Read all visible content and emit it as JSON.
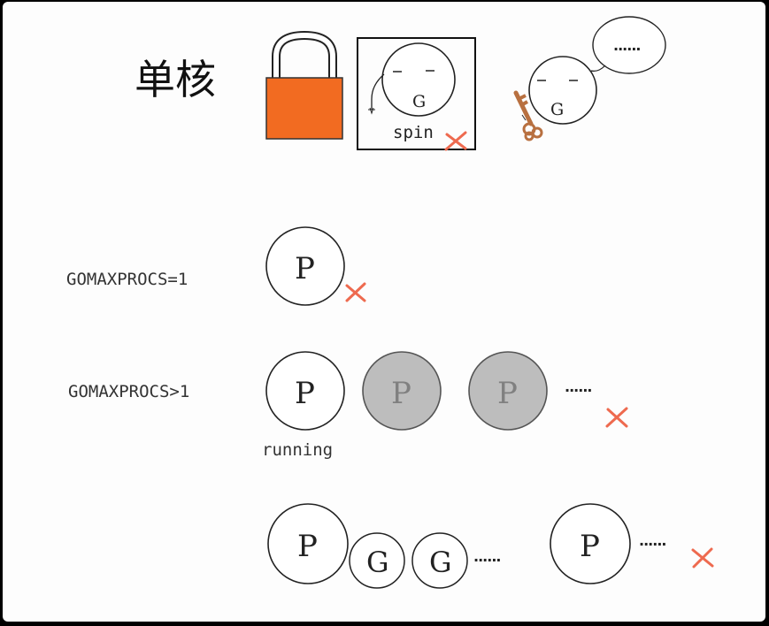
{
  "title": "单核",
  "colors": {
    "lock_body": "#f26b21",
    "cross": "#ee6a4f",
    "idle_p": "#bdbdbd",
    "idle_p_text": "#808080",
    "key": "#b87040",
    "stroke": "#222222"
  },
  "icons": [
    "padlock-icon",
    "goroutine-icon",
    "cross-icon",
    "key-icon",
    "speech-bubble-icon"
  ],
  "top": {
    "spin_label": "spin",
    "g_label": "G",
    "bubble_text": "......"
  },
  "rows": {
    "single": {
      "label": "GOMAXPROCS=1",
      "p_label": "P"
    },
    "multi": {
      "label": "GOMAXPROCS>1",
      "p_label": "P",
      "running_label": "running",
      "ellipsis": "......"
    },
    "queue": {
      "p_label": "P",
      "g_label": "G",
      "ellipsis": "......"
    }
  }
}
